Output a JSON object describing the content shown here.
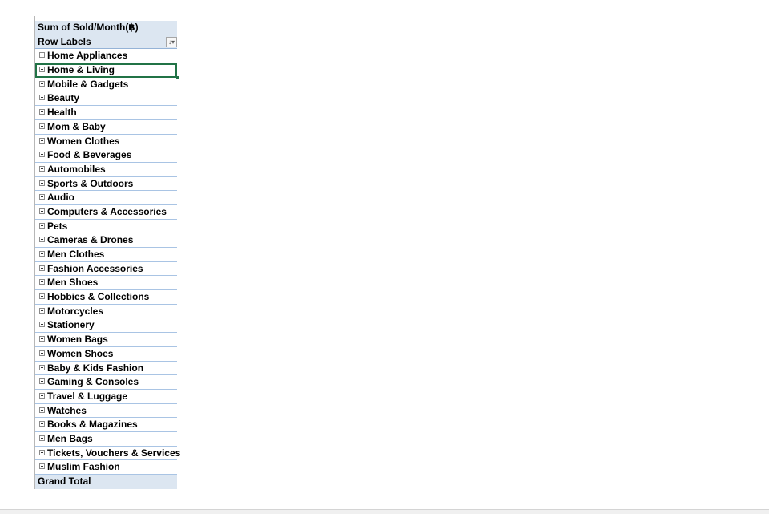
{
  "pivot": {
    "value_header": "Sum of Sold/Month(฿)",
    "row_labels": "Row Labels",
    "filter_icon": "filter-sort-icon",
    "categories": [
      "Home Appliances",
      "Home & Living",
      "Mobile & Gadgets",
      "Beauty",
      "Health",
      "Mom & Baby",
      "Women Clothes",
      "Food & Beverages",
      "Automobiles",
      "Sports & Outdoors",
      "Audio",
      "Computers & Accessories",
      "Pets",
      "Cameras & Drones",
      "Men Clothes",
      "Fashion Accessories",
      "Men Shoes",
      "Hobbies & Collections",
      "Motorcycles",
      "Stationery",
      "Women Bags",
      "Women Shoes",
      "Baby & Kids Fashion",
      "Gaming & Consoles",
      "Travel & Luggage",
      "Watches",
      "Books & Magazines",
      "Men Bags",
      "Tickets, Vouchers & Services",
      "Muslim Fashion"
    ],
    "active_category": "Home & Living",
    "grand_total": "Grand Total"
  },
  "colors": {
    "header_fill": "#dce6f1",
    "row_border": "#a9c4e4",
    "active_cell_border": "#217346"
  }
}
